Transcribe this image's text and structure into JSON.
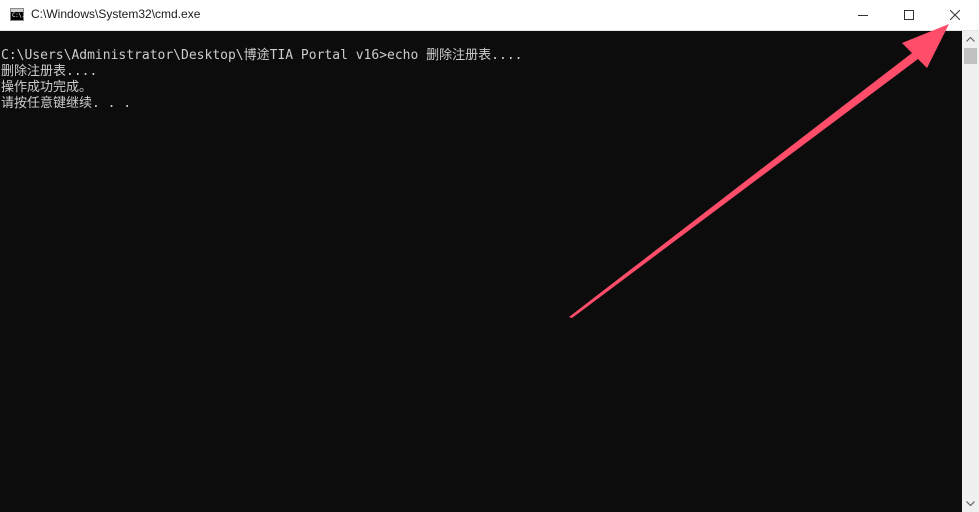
{
  "window": {
    "title": "C:\\Windows\\System32\\cmd.exe",
    "icon": "cmd-icon",
    "icon_text": "C:\\."
  },
  "controls": {
    "minimize_icon": "minimize-icon",
    "maximize_icon": "maximize-icon",
    "close_icon": "close-icon"
  },
  "console": {
    "background": "#0c0c0c",
    "text_color": "#cccccc",
    "lines": [
      "C:\\Users\\Administrator\\Desktop\\博途TIA Portal v16>echo 删除注册表....",
      "删除注册表....",
      "操作成功完成。",
      "请按任意键继续. . ."
    ]
  },
  "annotation": {
    "type": "arrow",
    "color": "#ff4d6a",
    "points_to": "close-button"
  }
}
